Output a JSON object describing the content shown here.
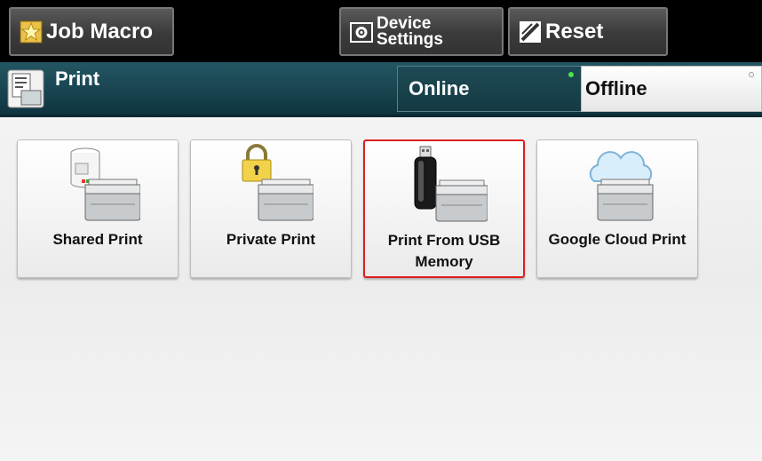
{
  "toolbar": {
    "job_macro": "Job Macro",
    "device_settings": [
      "Device",
      "Settings"
    ],
    "reset": "Reset"
  },
  "header": {
    "title": "Print",
    "online": "Online",
    "offline": "Offline"
  },
  "tiles": [
    {
      "label": "Shared Print",
      "icon": "shared-print-icon"
    },
    {
      "label": "Private Print",
      "icon": "private-print-icon"
    },
    {
      "label": "Print From USB Memory",
      "icon": "usb-print-icon",
      "selected": true
    },
    {
      "label": "Google Cloud Print",
      "icon": "cloud-print-icon"
    }
  ],
  "colors": {
    "topbar": "#000000",
    "header": "#1a4652",
    "selection": "#e01e1e",
    "online_indicator": "#4fe04a"
  }
}
